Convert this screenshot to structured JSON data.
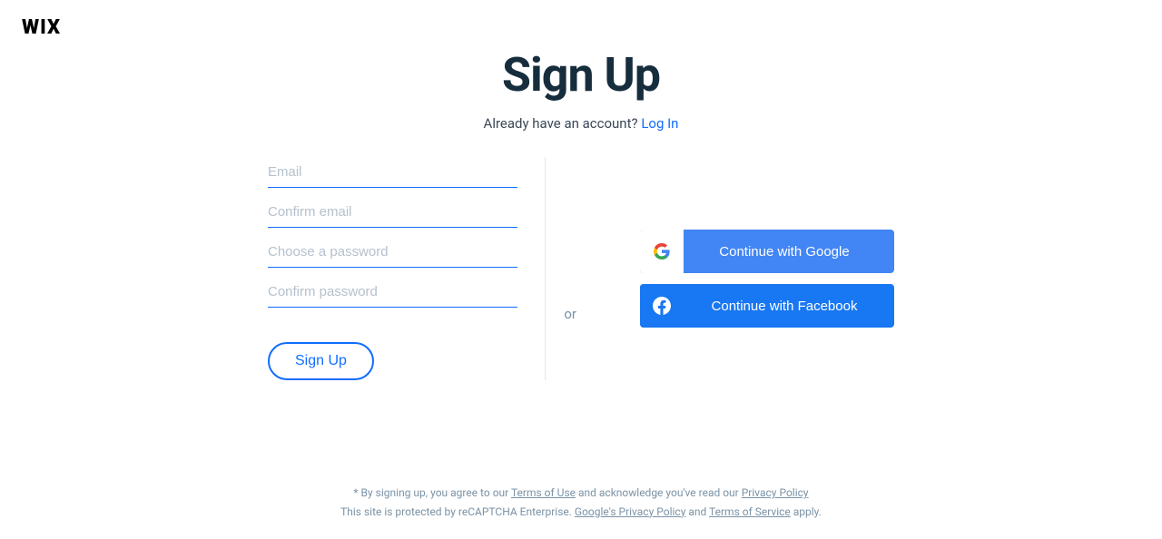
{
  "logo": {
    "text": "WIX"
  },
  "header": {
    "title": "Sign Up",
    "login_prompt": "Already have an account?",
    "login_link": "Log In"
  },
  "form": {
    "email_placeholder": "Email",
    "confirm_email_placeholder": "Confirm email",
    "password_placeholder": "Choose a password",
    "confirm_password_placeholder": "Confirm password",
    "signup_button": "Sign Up"
  },
  "social": {
    "or_text": "or",
    "google_button": "Continue with Google",
    "facebook_button": "Continue with Facebook"
  },
  "footer": {
    "line1_prefix": "* By signing up, you agree to our ",
    "terms_of_use": "Terms of Use",
    "line1_mid": " and acknowledge you've read our ",
    "privacy_policy": "Privacy Policy",
    "line2_prefix": "This site is protected by reCAPTCHA Enterprise. ",
    "google_privacy": "Google's Privacy Policy",
    "line2_and": " and ",
    "terms_of_service": "Terms of Service",
    "line2_suffix": " apply."
  }
}
